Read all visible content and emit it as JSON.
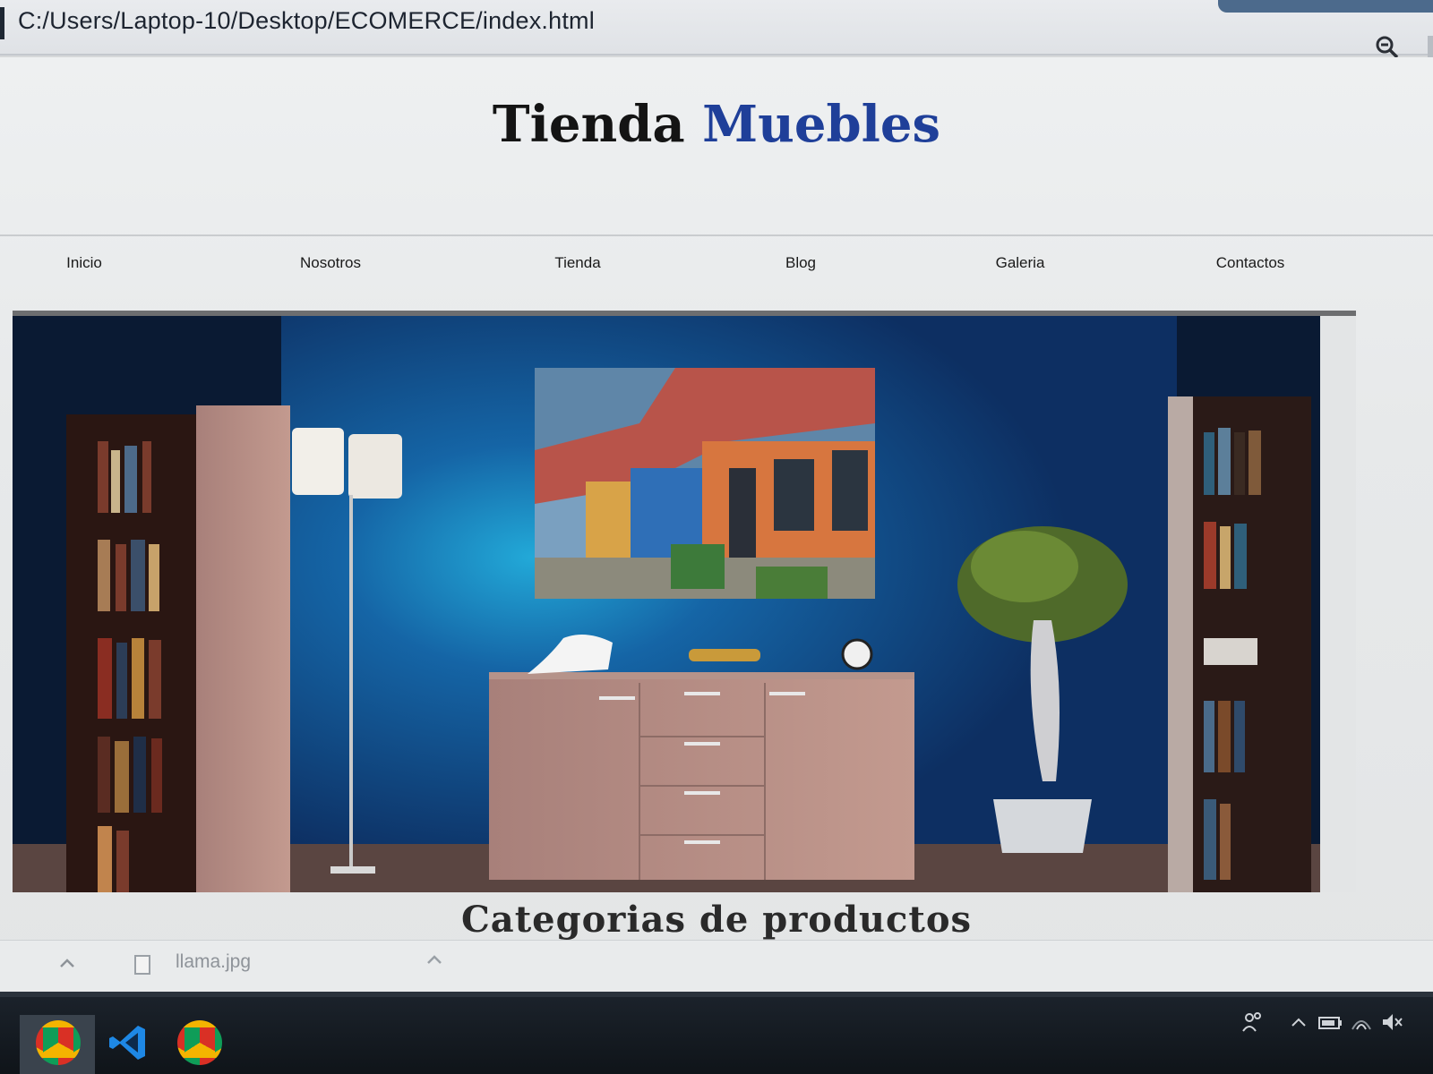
{
  "browser": {
    "url": "C:/Users/Laptop-10/Desktop/ECOMERCE/index.html",
    "icons": {
      "zoom": "magnifier-minus-icon"
    }
  },
  "site": {
    "title_part1": "Tienda",
    "title_part2": "Muebles",
    "title_accent_color": "#1f3f99",
    "nav": [
      "Inicio",
      "Nosotros",
      "Tienda",
      "Blog",
      "Galeria",
      "Contactos"
    ],
    "hero_image": "living-room-blue-wall-sideboard-photo",
    "section_title": "Categorias de productos"
  },
  "downloads": {
    "file_name": "llama.jpg",
    "icons": {
      "collapse": "chevron-up-icon",
      "file": "image-file-icon",
      "more": "chevron-up-icon"
    }
  },
  "taskbar": {
    "apps": [
      "chrome-icon",
      "vscode-icon",
      "chrome-icon"
    ],
    "tray": [
      "people-icon",
      "chevron-up-icon",
      "battery-icon",
      "wifi-icon",
      "volume-muted-icon"
    ]
  }
}
